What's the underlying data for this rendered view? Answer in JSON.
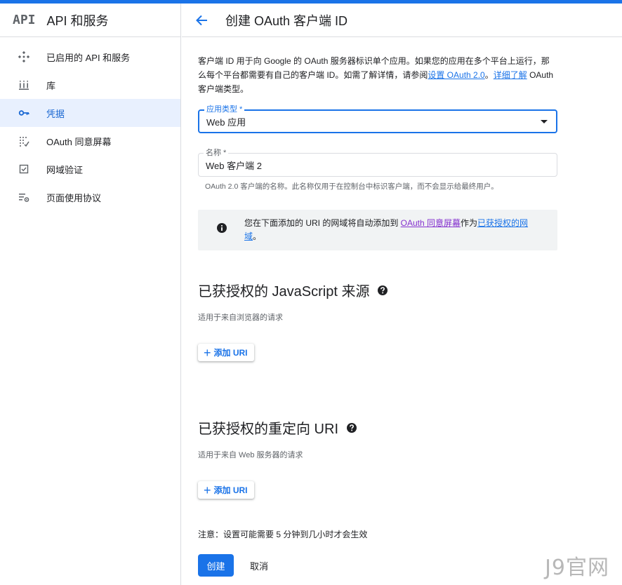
{
  "sidebar": {
    "logo": "API",
    "title": "API 和服务",
    "items": [
      {
        "label": "已启用的 API 和服务",
        "icon": "api-diamond-icon",
        "active": false
      },
      {
        "label": "库",
        "icon": "library-icon",
        "active": false
      },
      {
        "label": "凭据",
        "icon": "key-icon",
        "active": true
      },
      {
        "label": "OAuth 同意屏幕",
        "icon": "consent-dots-icon",
        "active": false
      },
      {
        "label": "网域验证",
        "icon": "checkbox-icon",
        "active": false
      },
      {
        "label": "页面使用协议",
        "icon": "settings-list-icon",
        "active": false
      }
    ]
  },
  "header": {
    "back_icon": "arrow-back-icon",
    "title": "创建 OAuth 客户端 ID"
  },
  "intro": {
    "text1": "客户端 ID 用于向 Google 的 OAuth 服务器标识单个应用。如果您的应用在多个平台上运行，那么每个平台都需要有自己的客户端 ID。如需了解详情，请参阅",
    "link1": "设置 OAuth 2.0",
    "text2": "。",
    "link2": "详细了解",
    "text3": " OAuth 客户端类型。"
  },
  "app_type": {
    "label": "应用类型 *",
    "value": "Web 应用"
  },
  "name_field": {
    "label": "名称 *",
    "value": "Web 客户端 2",
    "helper": "OAuth 2.0 客户端的名称。此名称仅用于在控制台中标识客户端，而不会显示给最终用户。"
  },
  "info": {
    "icon": "info-icon",
    "text1": "您在下面添加的 URI 的网域将自动添加到 ",
    "link1": "OAuth 同意屏幕",
    "text2": "作为",
    "link2": "已获授权的网域",
    "text3": "。"
  },
  "js_origins": {
    "title": "已获授权的 JavaScript 来源",
    "subtitle": "适用于来自浏览器的请求",
    "button": "添加 URI"
  },
  "redirect_uris": {
    "title": "已获授权的重定向 URI",
    "subtitle": "适用于来自 Web 服务器的请求",
    "button": "添加 URI"
  },
  "note": "注意：设置可能需要 5 分钟到几小时才会生效",
  "actions": {
    "create": "创建",
    "cancel": "取消"
  },
  "watermark": "J9官网",
  "colors": {
    "accent": "#1a73e8",
    "active_bg": "#e8f0fe",
    "visited_link": "#8430ce"
  }
}
